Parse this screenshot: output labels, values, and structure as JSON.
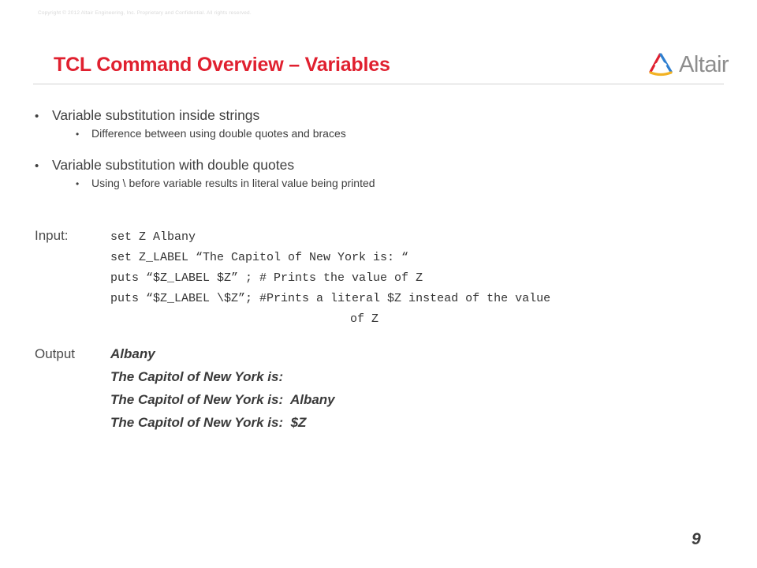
{
  "slide": {
    "copyright": "Copyright © 2012 Altair Engineering, Inc. Proprietary and Confidential. All rights reserved.",
    "title": "TCL Command Overview – Variables",
    "page_number": "9",
    "title_color": "#e0202f",
    "rule_color": "#d2d2d2"
  },
  "logo": {
    "wordmark": "Altair",
    "mark_colors": {
      "red": "#e0202f",
      "blue": "#2f7fd0",
      "yellow": "#f2b223"
    },
    "wordmark_color": "#8d8d8d"
  },
  "bullets": [
    {
      "level": 1,
      "marker": "•",
      "text": "Variable substitution inside strings"
    },
    {
      "level": 2,
      "marker": "•",
      "text": "Difference between using double quotes and braces"
    },
    {
      "level": 1,
      "marker": "•",
      "text": "Variable substitution with double quotes"
    },
    {
      "level": 2,
      "marker": "•",
      "text": "Using \\ before variable results in literal value being printed"
    }
  ],
  "input": {
    "label": "Input:",
    "lines": [
      "set Z Albany",
      "set Z_LABEL “The Capitol of New York is: “",
      "puts “$Z_LABEL $Z” ; # Prints the value of Z",
      "puts “$Z_LABEL \\$Z”; #Prints a literal $Z instead of the value",
      "of Z"
    ]
  },
  "output": {
    "label": "Output",
    "lines": [
      "Albany",
      "The Capitol of New York is:",
      "The Capitol of New York is:  Albany",
      "The Capitol of New York is:  $Z"
    ]
  }
}
